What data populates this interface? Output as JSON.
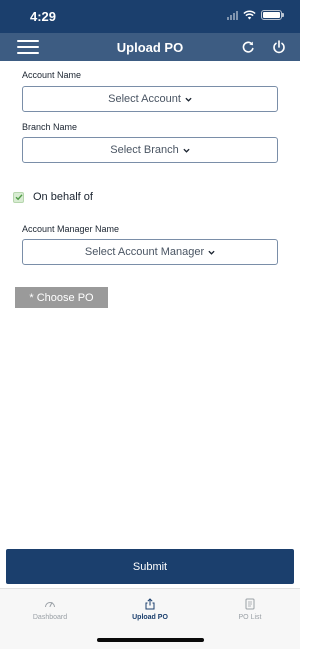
{
  "status_bar": {
    "time": "4:29"
  },
  "header": {
    "title": "Upload PO"
  },
  "form": {
    "account_name_label": "Account Name",
    "account_select": "Select Account",
    "branch_name_label": "Branch Name",
    "branch_select": "Select Branch",
    "on_behalf_label": "On behalf of",
    "on_behalf_checked": true,
    "account_manager_label": "Account Manager Name",
    "account_manager_select": "Select Account Manager",
    "choose_po_label": "* Choose PO"
  },
  "submit_label": "Submit",
  "tabs": [
    {
      "label": "Dashboard",
      "icon": "speedometer-icon",
      "active": false
    },
    {
      "label": "Upload PO",
      "icon": "upload-icon",
      "active": true
    },
    {
      "label": "PO List",
      "icon": "document-list-icon",
      "active": false
    }
  ],
  "colors": {
    "primary": "#1b3f6d",
    "nav": "#3d5c82",
    "disabled": "#9a9a9a"
  }
}
